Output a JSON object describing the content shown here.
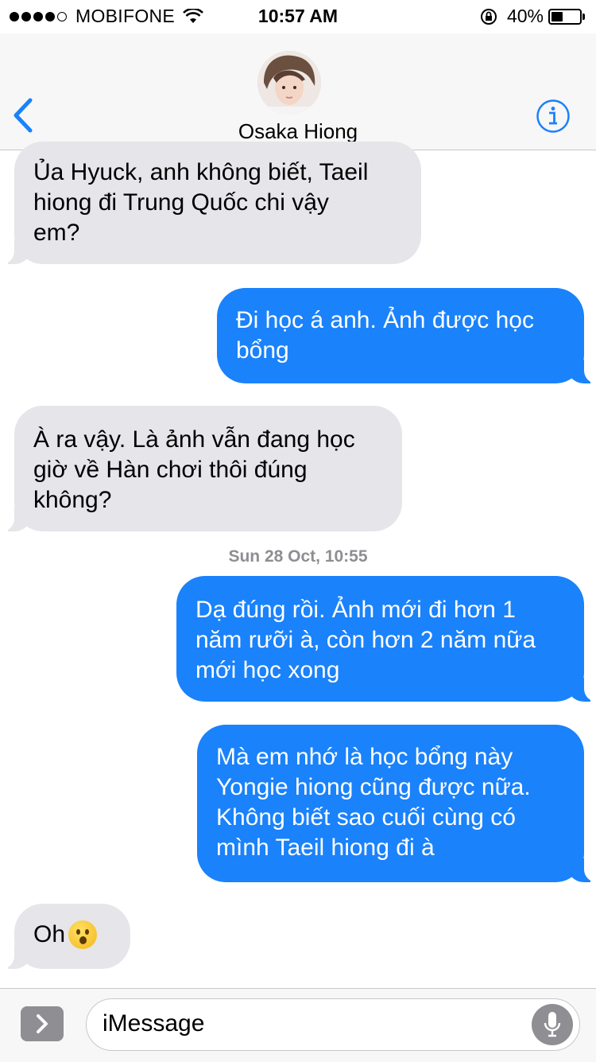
{
  "status_bar": {
    "carrier": "MOBIFONE",
    "time": "10:57 AM",
    "battery_text": "40%",
    "battery_level": 0.4,
    "signal_bars_filled": 4,
    "signal_bars_total": 5
  },
  "header": {
    "contact_name": "Osaka Hiong",
    "back_icon": "chevron-left-icon",
    "info_icon": "info-icon",
    "accent_color": "#1a82fb"
  },
  "messages": [
    {
      "direction": "received",
      "text": "Ủa Hyuck, anh không biết, Taeil\nhiong đi Trung Quốc chi vậy\nem?"
    },
    {
      "direction": "sent",
      "text": "Đi học á anh. Ảnh được học\nbổng"
    },
    {
      "direction": "received",
      "text": "À ra vậy. Là ảnh vẫn đang học\ngiờ về Hàn chơi thôi đúng\nkhông?"
    },
    {
      "direction": "sent",
      "text": "Dạ đúng rồi. Ảnh mới đi hơn 1\nnăm rưỡi à, còn hơn 2 năm nữa\nmới học xong"
    },
    {
      "direction": "sent",
      "text": "Mà em nhớ là học bổng này\nYongie hiong cũng được nữa.\nKhông biết sao cuối cùng có\nmình Taeil hiong đi à"
    },
    {
      "direction": "received",
      "text": "Oh",
      "emoji": "hushed-face-emoji"
    }
  ],
  "timestamp": "Sun 28 Oct, 10:55",
  "input": {
    "placeholder": "iMessage",
    "expand_icon": "chevron-right-icon",
    "mic_icon": "microphone-icon"
  },
  "colors": {
    "sent_bubble": "#1a82fb",
    "received_bubble": "#e5e5ea"
  }
}
